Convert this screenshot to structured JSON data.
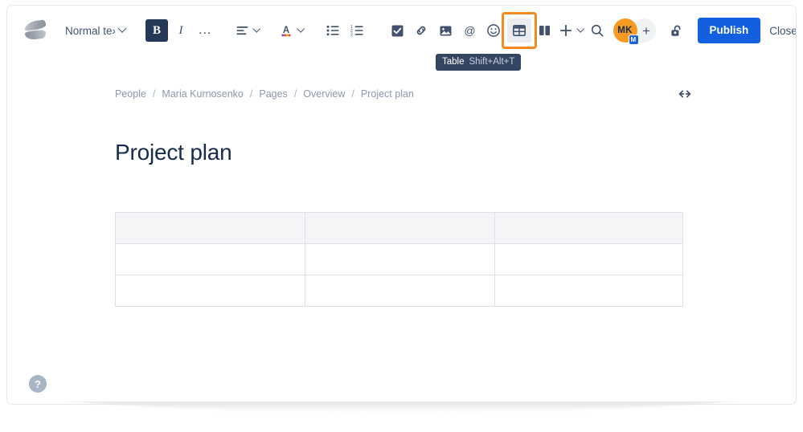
{
  "toolbar": {
    "logo_name": "confluence-logo",
    "text_style": {
      "label": "Normal te›",
      "full_label": "Normal text"
    },
    "bold_label": "B",
    "italic_label": "I",
    "more_formatting_label": "…",
    "align_name": "text-align",
    "text_color_label": "A",
    "bullet_list_name": "bullet-list",
    "numbered_list_name": "numbered-list",
    "action_item_name": "action-item-checkbox",
    "link_name": "link",
    "image_name": "image",
    "mention_label": "@",
    "emoji_name": "emoji",
    "table_name": "table",
    "layout_name": "page-layout",
    "insert_label": "+",
    "search_name": "search",
    "add_people_label": "+",
    "restrictions_name": "page-restrictions-unlocked",
    "publish_label": "Publish",
    "close_label": "Close",
    "more_options_label": "…"
  },
  "tooltip": {
    "title": "Table",
    "shortcut": "Shift+Alt+T"
  },
  "user": {
    "initials": "MK",
    "badge": "M"
  },
  "breadcrumb": {
    "items": [
      {
        "label": "People"
      },
      {
        "label": "Maria Kurnosenko"
      },
      {
        "label": "Pages"
      },
      {
        "label": "Overview"
      },
      {
        "label": "Project plan"
      }
    ],
    "separator": "/"
  },
  "page": {
    "title": "Project plan",
    "expand_width_name": "expand-page-width"
  },
  "table": {
    "rows": 3,
    "columns": 3,
    "header_row_shaded": true,
    "cells": [
      [
        "",
        "",
        ""
      ],
      [
        "",
        "",
        ""
      ],
      [
        "",
        "",
        ""
      ]
    ]
  },
  "help": {
    "label": "?"
  },
  "colors": {
    "accent_blue": "#1260df",
    "highlight_orange": "#f68a1e",
    "avatar_orange": "#f79a22",
    "toolbar_icon": "#42526e",
    "active_button": "#253858",
    "table_header_bg": "#f4f5f7",
    "table_border": "#dfe1e6",
    "tooltip_bg": "#344563",
    "breadcrumb_text": "#8c98ab",
    "title_text": "#172b4d"
  }
}
